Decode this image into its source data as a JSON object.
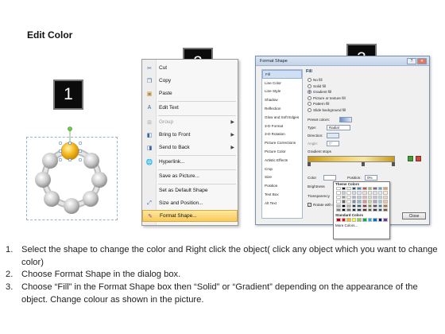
{
  "title": "Edit Color",
  "steps": [
    {
      "number": "1"
    },
    {
      "number": "2"
    },
    {
      "number": "3"
    }
  ],
  "context_menu": {
    "items": [
      {
        "label": "Cut",
        "icon": "scissors-icon"
      },
      {
        "label": "Copy",
        "icon": "copy-icon"
      },
      {
        "label": "Paste",
        "icon": "paste-icon"
      },
      {
        "label": "Edit Text",
        "icon": "edit-text-icon"
      },
      {
        "label": "Group",
        "icon": "group-icon",
        "disabled": true,
        "submenu": true
      },
      {
        "label": "Bring to Front",
        "icon": "bring-front-icon",
        "submenu": true
      },
      {
        "label": "Send to Back",
        "icon": "send-back-icon",
        "submenu": true
      },
      {
        "label": "Hyperlink...",
        "icon": "hyperlink-icon"
      },
      {
        "label": "Save as Picture...",
        "icon": ""
      },
      {
        "label": "Set as Default Shape",
        "icon": ""
      },
      {
        "label": "Size and Position...",
        "icon": "size-position-icon"
      },
      {
        "label": "Format Shape...",
        "icon": "format-shape-icon",
        "highlighted": true
      }
    ]
  },
  "format_dialog": {
    "title": "Format Shape",
    "nav": [
      "Fill",
      "Line Color",
      "Line Style",
      "Shadow",
      "Reflection",
      "Glow and Soft Edges",
      "3-D Format",
      "3-D Rotation",
      "Picture Corrections",
      "Picture Color",
      "Artistic Effects",
      "Crop",
      "Size",
      "Position",
      "Text Box",
      "Alt Text"
    ],
    "panel_heading": "Fill",
    "fill_options": [
      "No fill",
      "Solid fill",
      "Gradient fill",
      "Picture or texture fill",
      "Pattern fill",
      "Slide background fill"
    ],
    "selected_fill": "Gradient fill",
    "preset_label": "Preset colors:",
    "type_label": "Type:",
    "type_value": "Radial",
    "direction_label": "Direction:",
    "angle_label": "Angle:",
    "angle_value": "0°",
    "gradient_stops_label": "Gradient stops",
    "color_label": "Color",
    "position_label": "Position:",
    "position_value": "0%",
    "brightness_label": "Brightness",
    "transparency_label": "Transparency",
    "rotate_label": "Rotate with shape",
    "close_label": "Close",
    "palette": {
      "theme_heading": "Theme Colors",
      "standard_heading": "Standard Colors",
      "more_colors": "More Colors...",
      "theme_colors": [
        "#ffffff",
        "#000000",
        "#eeece1",
        "#1f497d",
        "#4f81bd",
        "#c0504d",
        "#9bbb59",
        "#8064a2",
        "#4bacc6",
        "#f79646"
      ],
      "standard_colors": [
        "#c00000",
        "#ff0000",
        "#ffc000",
        "#ffff00",
        "#92d050",
        "#00b050",
        "#00b0f0",
        "#0070c0",
        "#002060",
        "#7030a0"
      ]
    }
  },
  "instructions": [
    {
      "n": "1.",
      "text": "Select the shape to change the color and Right click the object( click any object which you want to change color)"
    },
    {
      "n": "2.",
      "text": "Choose Format Shape in the dialog box."
    },
    {
      "n": "3.",
      "text": "Choose “Fill” in the Format Shape box then “Solid” or “Gradient” depending on the appearance of the object. Change colour as shown in the picture."
    }
  ]
}
